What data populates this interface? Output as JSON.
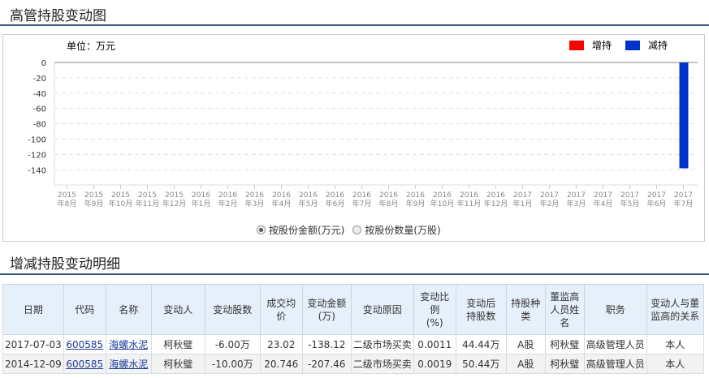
{
  "chart_title": "高管持股变动图",
  "detail_title": "增减持股变动明细",
  "chart_data": {
    "type": "bar",
    "unit_label": "单位：万元",
    "legend": [
      {
        "name": "增持",
        "color": "#ff0000"
      },
      {
        "name": "减持",
        "color": "#0033cc"
      }
    ],
    "legend_position": "top-right",
    "categories": [
      [
        "2015",
        "年8月"
      ],
      [
        "2015",
        "年9月"
      ],
      [
        "2015",
        "年10月"
      ],
      [
        "2015",
        "年11月"
      ],
      [
        "2015",
        "年12月"
      ],
      [
        "2016",
        "年1月"
      ],
      [
        "2016",
        "年2月"
      ],
      [
        "2016",
        "年3月"
      ],
      [
        "2016",
        "年4月"
      ],
      [
        "2016",
        "年5月"
      ],
      [
        "2016",
        "年6月"
      ],
      [
        "2016",
        "年7月"
      ],
      [
        "2016",
        "年8月"
      ],
      [
        "2016",
        "年9月"
      ],
      [
        "2016",
        "年10月"
      ],
      [
        "2016",
        "年11月"
      ],
      [
        "2016",
        "年12月"
      ],
      [
        "2017",
        "年1月"
      ],
      [
        "2017",
        "年2月"
      ],
      [
        "2017",
        "年3月"
      ],
      [
        "2017",
        "年4月"
      ],
      [
        "2017",
        "年5月"
      ],
      [
        "2017",
        "年6月"
      ],
      [
        "2017",
        "年7月"
      ]
    ],
    "values": [
      0,
      0,
      0,
      0,
      0,
      0,
      0,
      0,
      0,
      0,
      0,
      0,
      0,
      0,
      0,
      0,
      0,
      0,
      0,
      0,
      0,
      0,
      0,
      -138.12
    ],
    "yticks": [
      0,
      -20,
      -40,
      -60,
      -80,
      -100,
      -120,
      -140
    ],
    "ylim": [
      -160,
      0
    ],
    "grid": true
  },
  "radios": [
    {
      "label": "按股份金额(万元)",
      "checked": true
    },
    {
      "label": "按股份数量(万股)",
      "checked": false
    }
  ],
  "table": {
    "headers": [
      [
        "日期"
      ],
      [
        "代码"
      ],
      [
        "名称"
      ],
      [
        "变动人"
      ],
      [
        "变动股数"
      ],
      [
        "成交均价"
      ],
      [
        "变动金额",
        "(万)"
      ],
      [
        "变动原因"
      ],
      [
        "变动比例",
        "(%)"
      ],
      [
        "变动后",
        "持股数"
      ],
      [
        "持股种",
        "类"
      ],
      [
        "董监高",
        "人员姓",
        "名"
      ],
      [
        "职务"
      ],
      [
        "变动人与董",
        "监高的关系"
      ]
    ],
    "rows": [
      [
        "2017-07-03",
        "600585",
        "海螺水泥",
        "柯秋璧",
        "-6.00万",
        "23.02",
        "-138.12",
        "二级市场买卖",
        "0.0011",
        "44.44万",
        "A股",
        "柯秋璧",
        "高级管理人员",
        "本人"
      ],
      [
        "2014-12-09",
        "600585",
        "海螺水泥",
        "柯秋璧",
        "-10.00万",
        "20.746",
        "-207.46",
        "二级市场买卖",
        "0.0019",
        "50.44万",
        "A股",
        "柯秋璧",
        "高级管理人员",
        "本人"
      ]
    ]
  }
}
